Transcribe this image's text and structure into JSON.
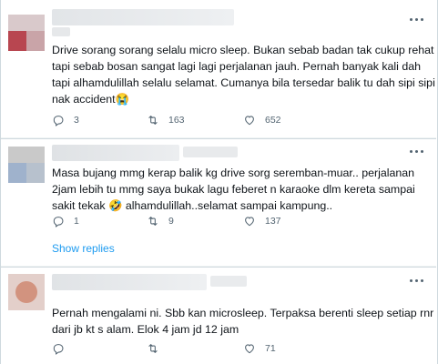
{
  "tweets": [
    {
      "lines": [
        "Drive sorang sorang selalu micro sleep. Bukan sebab badan tak cukup rehat",
        "tapi sebab bosan sangat lagi lagi perjalanan jauh. Pernah banyak kali dah",
        "tapi alhamdulillah selalu selamat. Cumanya bila tersedar balik tu dah sipi sipi",
        "nak accident😭"
      ],
      "replies": "3",
      "retweets": "163",
      "likes": "652"
    },
    {
      "lines": [
        "Masa bujang mmg kerap balik kg drive sorg seremban-muar.. perjalanan",
        "2jam lebih tu mmg saya bukak lagu feberet n karaoke dlm kereta sampai",
        "sakit tekak 🤣 alhamdulillah..selamat sampai kampung.."
      ],
      "replies": "1",
      "retweets": "9",
      "likes": "137",
      "show_replies": "Show replies"
    },
    {
      "lines": [
        "Pernah mengalami ni. Sbb kan microsleep. Terpaksa berenti sleep setiap rnr",
        "dari jb kt s alam. Elok 4 jam jd 12 jam"
      ],
      "replies": "",
      "retweets": "",
      "likes": "71"
    }
  ],
  "icons": {
    "reply": "reply-icon",
    "retweet": "retweet-icon",
    "like": "heart-icon",
    "views": "views-icon",
    "more": "more-icon"
  },
  "colors": {
    "text": "#0f1419",
    "muted": "#536471",
    "link": "#1d9bf0"
  }
}
